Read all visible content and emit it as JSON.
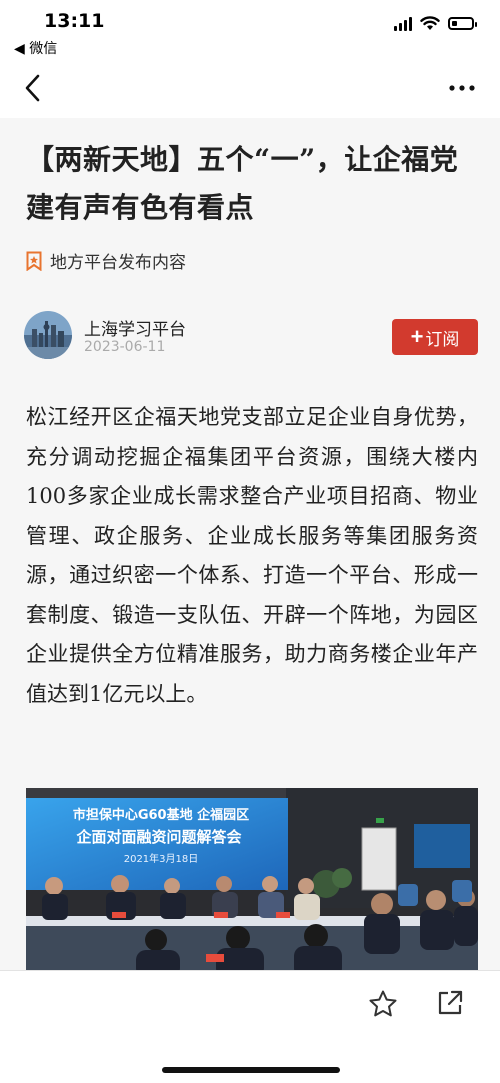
{
  "status_bar": {
    "time": "13:11",
    "back_app": "◀ 微信",
    "battery_level": 0.3
  },
  "nav": {
    "back_icon": "chevron-left-icon",
    "more_icon": "more-horizontal-icon"
  },
  "article": {
    "title": "【两新天地】五个“一”，让企福党建有声有色有看点",
    "source_label": "地方平台发布内容",
    "author": {
      "name": "上海学习平台",
      "date": "2023-06-11"
    },
    "subscribe_label": "订阅",
    "subscribe_plus": "+",
    "body": "松江经开区企福天地党支部立足企业自身优势，充分调动挖掘企福集团平台资源，围绕大楼内100多家企业成长需求整合产业项目招商、物业管理、政企服务、企业成长服务等集团服务资源，通过织密一个体系、打造一个平台、形成一套制度、锻造一支队伍、开辟一个阵地，为园区企业提供全方位精准服务，助力商务楼企业年产值达到1亿元以上。",
    "photo": {
      "banner_line1": "市担保中心G60基地  企福园区",
      "banner_line2": "企面对面融资问题解答会",
      "banner_date": "2021年3月18日"
    }
  },
  "colors": {
    "accent": "#d23a2e",
    "article_bg": "#f6f6f6",
    "bookmark_icon": "#e8742f"
  },
  "bottom_bar": {
    "favorite_icon": "star-icon",
    "share_icon": "share-external-icon"
  }
}
